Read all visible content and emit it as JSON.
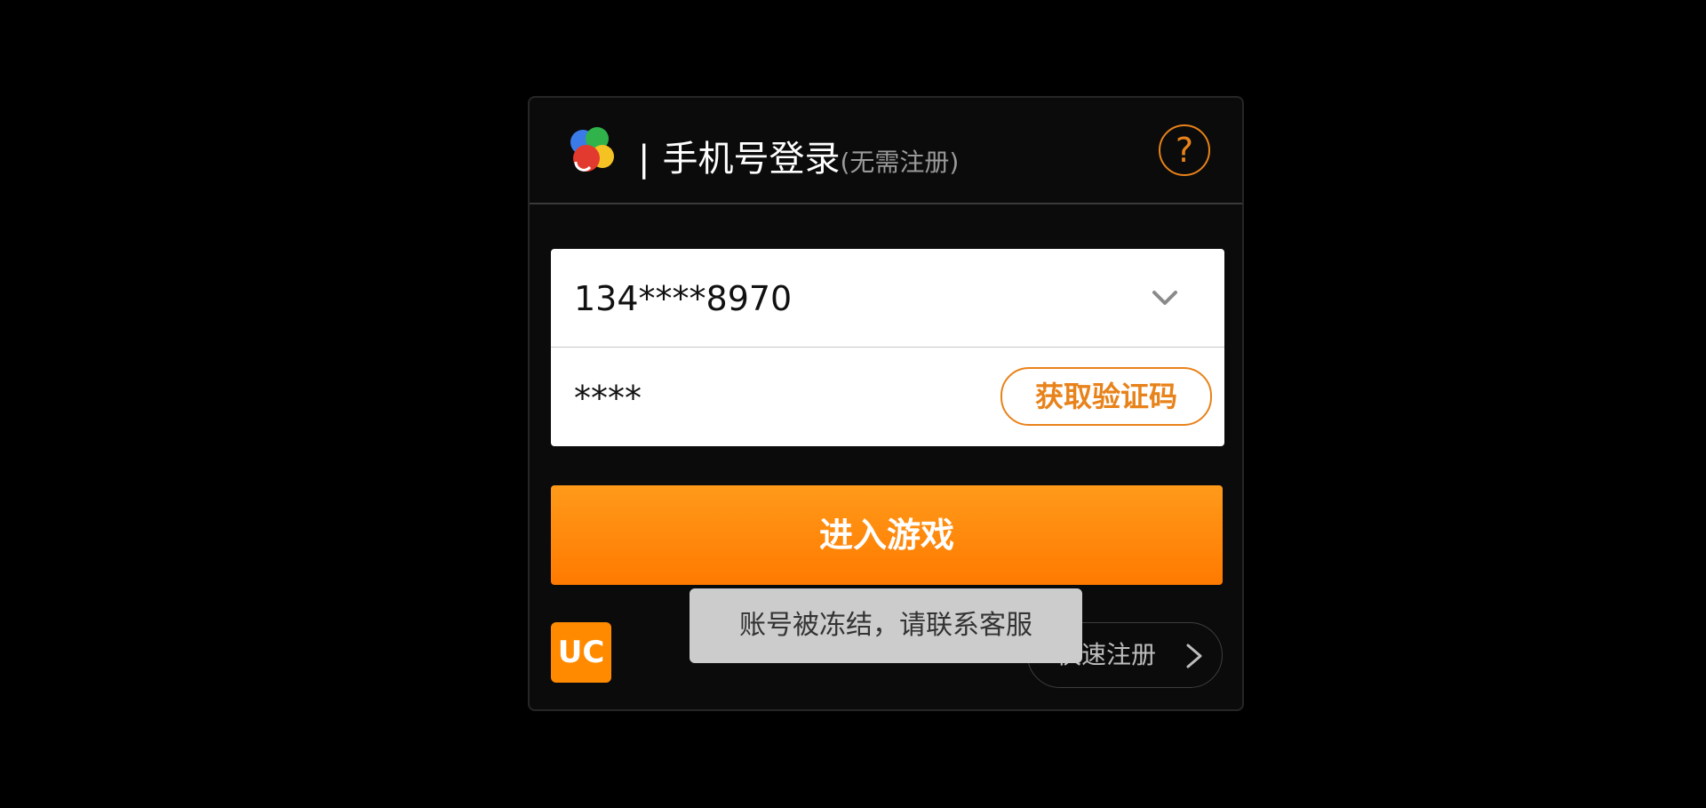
{
  "header": {
    "bar": "|",
    "title": "手机号登录",
    "subtitle": "(无需注册)",
    "help_symbol": "?"
  },
  "form": {
    "phone_value": "134****8970",
    "code_value": "****",
    "get_code_label": "获取验证码"
  },
  "enter_button_label": "进入游戏",
  "footer": {
    "uc_logo_text": "UC",
    "quick_register_label": "快速注册"
  },
  "toast": {
    "message": "账号被冻结，请联系客服"
  },
  "icons": {
    "logo": "colorful-petals-logo-icon",
    "help": "question-mark-icon",
    "dropdown": "chevron-down-icon",
    "quick_register_arrow": "chevron-right-icon"
  },
  "colors": {
    "accent": "#E8821A",
    "button_top": "#FF9A1A",
    "button_bottom": "#FF7A00",
    "background": "#000000",
    "panel": "#0B0B0B",
    "toast_bg": "#CCCCCC"
  }
}
